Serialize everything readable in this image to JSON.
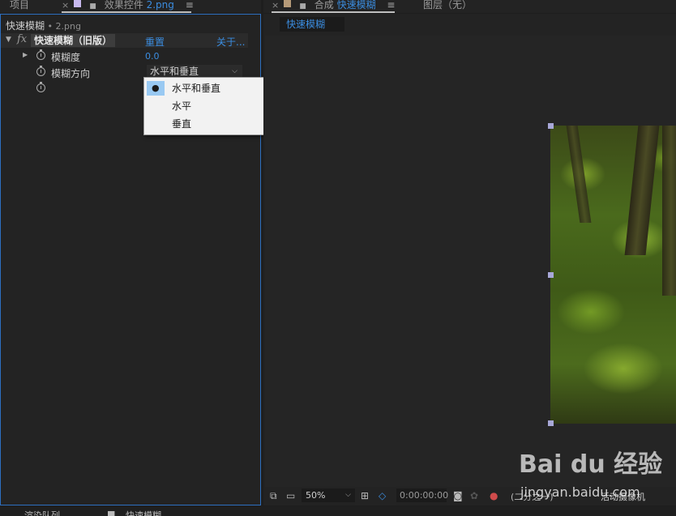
{
  "left_tabs": {
    "project_label": "项目",
    "close_glyph": "×",
    "effect_controls_label": "效果控件",
    "effect_controls_file": "2.png",
    "menu_glyph": "≡"
  },
  "effect_panel": {
    "layer_name": "快速模糊",
    "layer_sub": " • 2.png",
    "fx_label": "fx",
    "effect_name": "快速模糊（旧版）",
    "reset_link": "重置",
    "about_link": "关于...",
    "properties": [
      {
        "label": "模糊度",
        "value": "0.0"
      },
      {
        "label": "模糊方向",
        "value": "水平和垂直"
      }
    ],
    "dropdown_menu": {
      "items": [
        "水平和垂直",
        "水平",
        "垂直"
      ],
      "selected": "水平和垂直",
      "selected_marker": "●"
    }
  },
  "right_tabs": {
    "close_glyph": "×",
    "comp_prefix": "合成",
    "comp_name": "快速模糊",
    "menu_glyph": "≡",
    "layer_label": "图层（无）"
  },
  "comp_panel": {
    "subtab_label": "快速模糊",
    "zoom": "50%",
    "timecode": "0:00:00:00",
    "resolution": "(二分之一)",
    "camera": "活动摄像机"
  },
  "bottom_bar": {
    "left_text": "渲染队列",
    "right_text": "快速模糊"
  },
  "watermark": {
    "brand": "Bai du 经验",
    "url": "jingyan.baidu.com"
  },
  "colors": {
    "accent_blue": "#3b8de0",
    "panel_bg": "#232323",
    "menu_highlight": "#99c9f2",
    "panel_border": "#2d6fc0"
  }
}
